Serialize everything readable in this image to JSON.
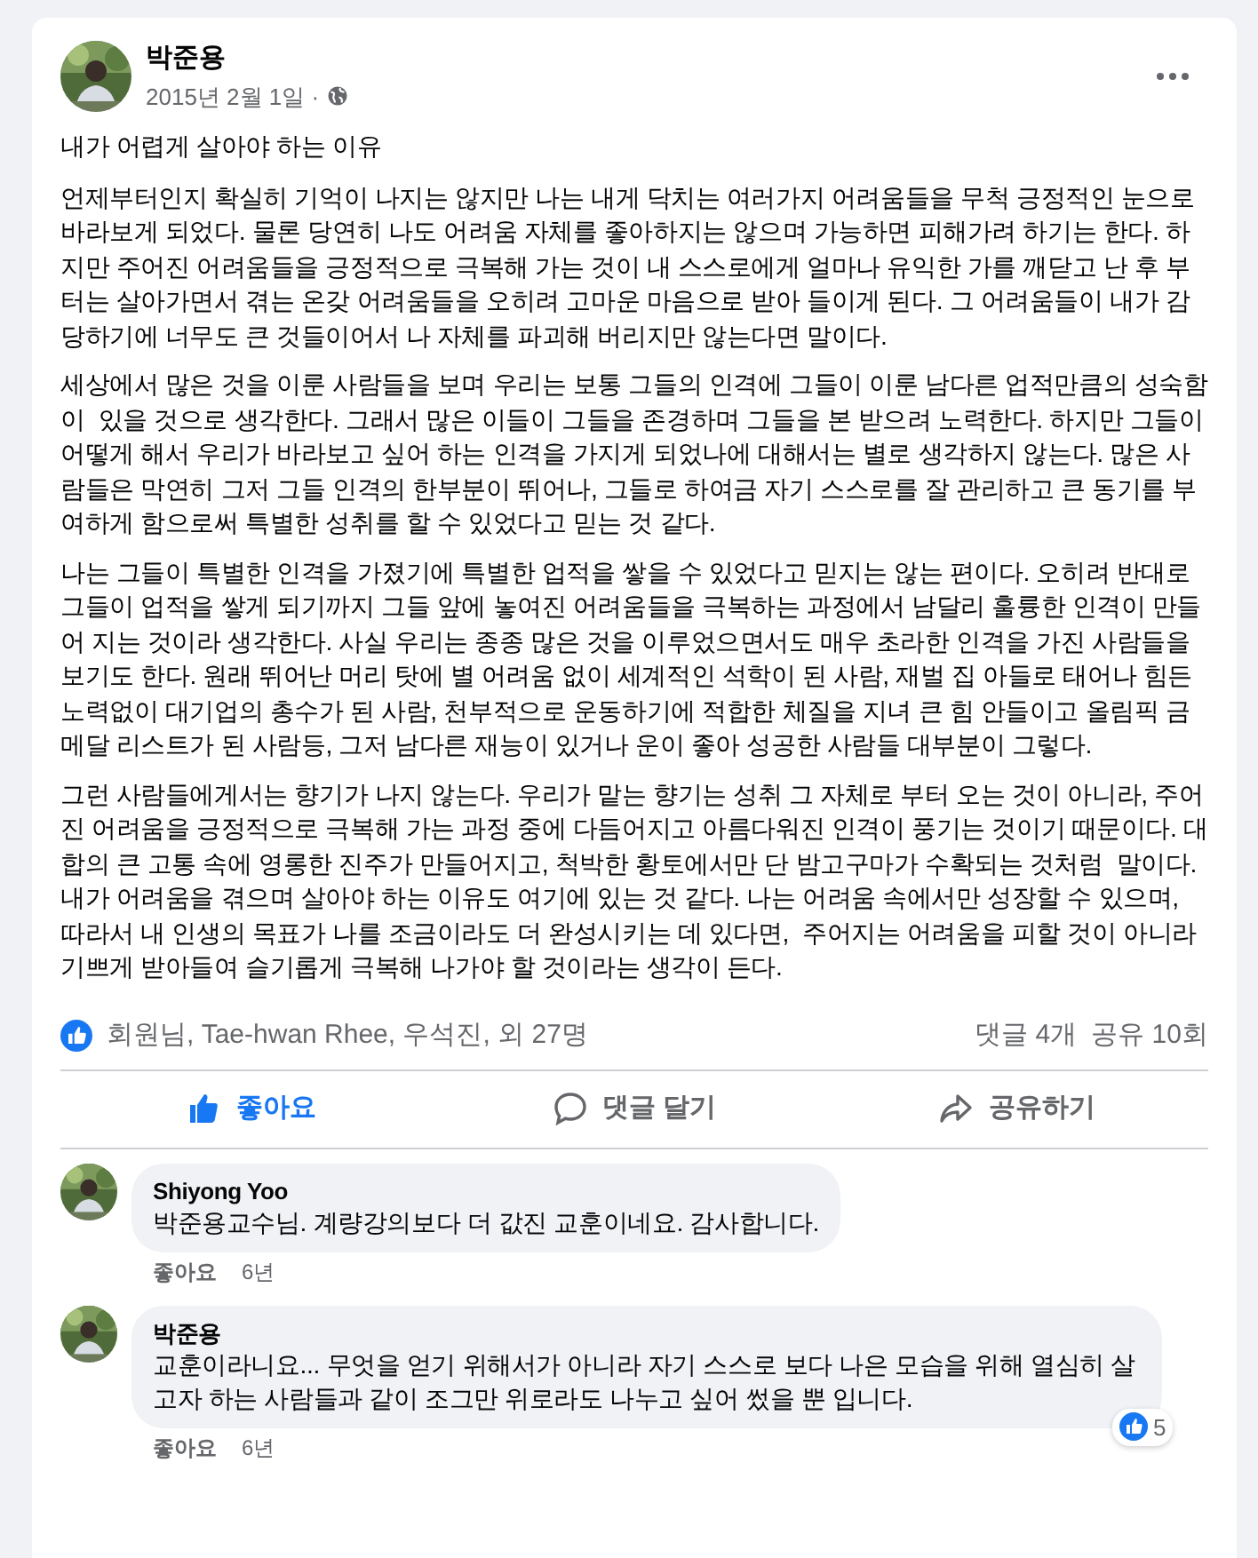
{
  "post": {
    "author": "박준용",
    "date": "2015년 2월 1일 ·",
    "title": "내가 어렵게 살아야 하는 이유",
    "paragraphs": [
      "언제부터인지 확실히 기억이 나지는 않지만 나는 내게 닥치는 여러가지 어려움들을 무척 긍정적인 눈으로 바라보게 되었다. 물론 당연히 나도 어려움 자체를 좋아하지는 않으며 가능하면 피해가려 하기는 한다. 하지만 주어진 어려움들을 긍정적으로 극복해 가는 것이 내 스스로에게 얼마나 유익한 가를 깨닫고 난 후 부터는 살아가면서 겪는 온갖 어려움들을 오히려 고마운 마음으로 받아 들이게 된다. 그 어려움들이 내가 감당하기에 너무도 큰 것들이어서 나 자체를 파괴해 버리지만 않는다면 말이다.",
      "세상에서 많은 것을 이룬 사람들을 보며 우리는 보통 그들의 인격에 그들이 이룬 남다른 업적만큼의 성숙함이  있을 것으로 생각한다. 그래서 많은 이들이 그들을 존경하며 그들을 본 받으려 노력한다. 하지만 그들이 어떻게 해서 우리가 바라보고 싶어 하는 인격을 가지게 되었나에 대해서는 별로 생각하지 않는다. 많은 사람들은 막연히 그저 그들 인격의 한부분이 뛰어나, 그들로 하여금 자기 스스로를 잘 관리하고 큰 동기를 부여하게 함으로써 특별한 성취를 할 수 있었다고 믿는 것 같다.",
      "나는 그들이 특별한 인격을 가졌기에 특별한 업적을 쌓을 수 있었다고 믿지는 않는 편이다. 오히려 반대로 그들이 업적을 쌓게 되기까지 그들 앞에 놓여진 어려움들을 극복하는 과정에서 남달리 훌륭한 인격이 만들어 지는 것이라 생각한다. 사실 우리는 종종 많은 것을 이루었으면서도 매우 초라한 인격을 가진 사람들을 보기도 한다. 원래 뛰어난 머리 탓에 별 어려움 없이 세계적인 석학이 된 사람, 재벌 집 아들로 태어나 힘든 노력없이 대기업의 총수가 된 사람, 천부적으로 운동하기에 적합한 체질을 지녀 큰 힘 안들이고 올림픽 금메달 리스트가 된 사람등, 그저 남다른 재능이 있거나 운이 좋아 성공한 사람들 대부분이 그렇다.",
      "그런 사람들에게서는 향기가 나지 않는다. 우리가 맡는 향기는 성취 그 자체로 부터 오는 것이 아니라, 주어진 어려움을 긍정적으로 극복해 가는 과정 중에 다듬어지고 아름다워진 인격이 풍기는 것이기 때문이다. 대합의 큰 고통 속에 영롱한 진주가 만들어지고, 척박한 황토에서만 단 밤고구마가 수확되는 것처럼  말이다. 내가 어려움을 겪으며 살아야 하는 이유도 여기에 있는 것 같다. 나는 어려움 속에서만 성장할 수 있으며, 따라서 내 인생의 목표가 나를 조금이라도 더 완성시키는 데 있다면,  주어지는 어려움을 피할 것이 아니라 기쁘게 받아들여 슬기롭게 극복해 나가야 할 것이라는 생각이 든다."
    ],
    "reactions": "회원님, Tae-hwan Rhee, 우석진, 외 27명",
    "comments_count": "댓글 4개",
    "shares_count": "공유 10회"
  },
  "actions": [
    {
      "label": "좋아요",
      "kind": "like",
      "selected": true
    },
    {
      "label": "댓글 달기",
      "kind": "comment",
      "selected": false
    },
    {
      "label": "공유하기",
      "kind": "share",
      "selected": false
    }
  ],
  "comments": [
    {
      "author": "Shiyong Yoo",
      "text": "박준용교수님. 계량강의보다 더 값진 교훈이네요. 감사합니다.",
      "like": "좋아요",
      "time": "6년"
    },
    {
      "author": "박준용",
      "text": "교훈이라니요... 무엇을 얻기 위해서가 아니라 자기 스스로 보다 나은 모습을 위해 열심히 살고자 하는 사람들과 같이 조그만 위로라도 나누고 싶어 썼을 뿐 입니다.",
      "like": "좋아요",
      "time": "6년",
      "reaction_count": "5"
    }
  ]
}
